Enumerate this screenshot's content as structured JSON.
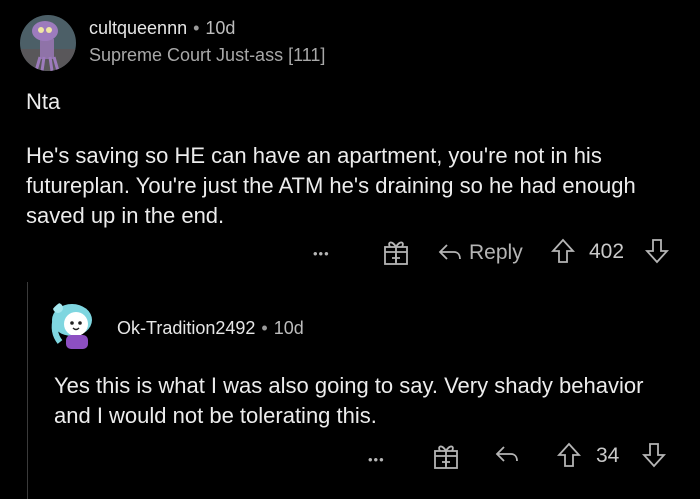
{
  "comment": {
    "username": "cultqueennn",
    "separator": "•",
    "age": "10d",
    "flair": "Supreme Court Just-ass [111]",
    "paragraphs": [
      "Nta",
      "He's saving so HE can have an apartment, you're not in his futureplan. You're just the ATM he's draining so he had enough saved up in the end."
    ],
    "actions": {
      "more": "•••",
      "reply_label": "Reply",
      "score": "402"
    }
  },
  "reply": {
    "username": "Ok-Tradition2492",
    "separator": "•",
    "age": "10d",
    "paragraphs": [
      "Yes this is what I was also going to say. Very shady behavior and I would not be tolerating this."
    ],
    "actions": {
      "more": "•••",
      "score": "34"
    }
  },
  "colors": {
    "background": "#000000",
    "text": "#ececec",
    "muted": "#b5b5b5"
  },
  "icons": [
    "more-icon",
    "gift-icon",
    "reply-icon",
    "upvote-icon",
    "downvote-icon"
  ]
}
